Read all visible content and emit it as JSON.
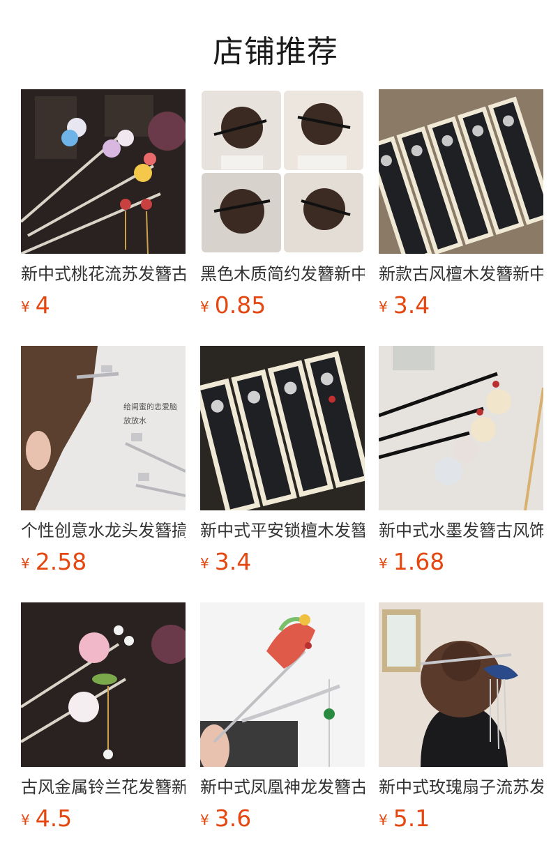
{
  "header": {
    "title": "店铺推荐"
  },
  "currency_symbol": "¥",
  "products": [
    {
      "name": "新中式桃花流苏发簪古风",
      "price": "4",
      "image_icon": "hairpin-flower-tassel-icon"
    },
    {
      "name": "黑色木质简约发簪新中式",
      "price": "0.85",
      "image_icon": "hair-bun-black-stick-icon"
    },
    {
      "name": "新款古风檀木发簪新中式",
      "price": "3.4",
      "image_icon": "sandalwood-hairpins-box-icon"
    },
    {
      "name": "个性创意水龙头发簪搞怪",
      "price": "2.58",
      "image_icon": "faucet-hairpin-icon",
      "image_caption": [
        "给闺蜜的恋爱脑",
        "放放水"
      ]
    },
    {
      "name": "新中式平安锁檀木发簪古",
      "price": "3.4",
      "image_icon": "sandalwood-hairpins-box-icon"
    },
    {
      "name": "新中式水墨发簪古风饰品",
      "price": "1.68",
      "image_icon": "ink-painting-hairpins-icon"
    },
    {
      "name": "古风金属铃兰花发簪新款",
      "price": "4.5",
      "image_icon": "lily-of-valley-hairpin-icon"
    },
    {
      "name": "新中式凤凰神龙发簪古风",
      "price": "3.6",
      "image_icon": "phoenix-dragon-hairpin-icon"
    },
    {
      "name": "新中式玫瑰扇子流苏发簪",
      "price": "5.1",
      "image_icon": "rose-fan-tassel-hairpin-icon"
    }
  ]
}
